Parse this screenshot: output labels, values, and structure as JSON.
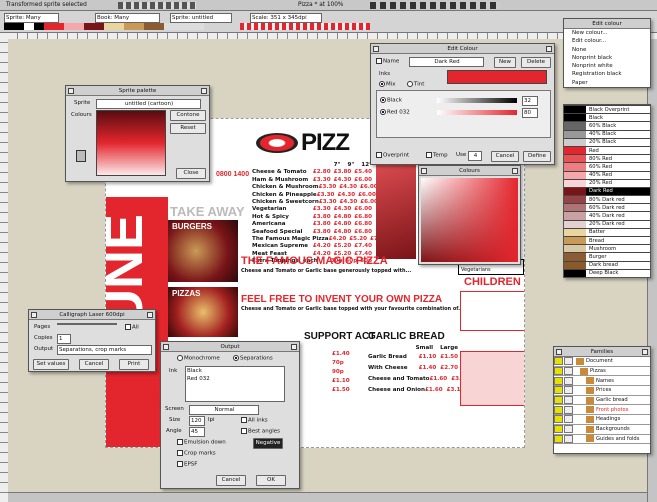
{
  "menubar": {
    "doc_title": "Transformed sprite selected",
    "window_title": "Pizza * at 100%"
  },
  "toolbar": {
    "sprite": "Sprite: Many",
    "book": "Book: Many",
    "sprite_name": "Sprite: untitled",
    "scale": "Scale: 351 x 345dpi"
  },
  "sprite_window": {
    "title": "Sprite palette",
    "sprite_label": "Sprite",
    "sprite_value": "untitled (cartoon)",
    "colours_label": "Colours",
    "contone": "Contone",
    "reset": "Reset",
    "close": "Close"
  },
  "edit_colour": {
    "title": "Edit Colour",
    "name_label": "Name",
    "name_value": "Dark Red",
    "new": "New",
    "delete": "Delete",
    "inks": "Inks",
    "mix": "Mix",
    "tint": "Tint",
    "ink1": "Black",
    "ink2": "Red 032",
    "v1": "32",
    "v2": "80",
    "overprint": "Overprint",
    "temp": "Temp",
    "use": "Use",
    "use_value": "4",
    "cancel": "Cancel",
    "define": "Define"
  },
  "colours_panel": {
    "title": "Colours"
  },
  "edit_menu": {
    "title": "Edit colour",
    "items": [
      "New colour...",
      "Edit colour...",
      "None",
      "Nonprint black",
      "Nonprint white",
      "Registration black",
      "Paper"
    ]
  },
  "palette": [
    {
      "name": "Black Overprint",
      "color": "#000000"
    },
    {
      "name": "Black",
      "color": "#000000"
    },
    {
      "name": "60% Black",
      "color": "#666666"
    },
    {
      "name": "40% Black",
      "color": "#999999"
    },
    {
      "name": "20% Black",
      "color": "#cccccc"
    },
    {
      "name": "Red",
      "color": "#e3262d"
    },
    {
      "name": "80% Red",
      "color": "#e85257"
    },
    {
      "name": "60% Red",
      "color": "#ee7d81"
    },
    {
      "name": "40% Red",
      "color": "#f4a8ab"
    },
    {
      "name": "20% Red",
      "color": "#f9d4d5"
    },
    {
      "name": "Dark Red",
      "color": "#7a1418"
    },
    {
      "name": "80% Dark red",
      "color": "#954347"
    },
    {
      "name": "60% Dark red",
      "color": "#af7275"
    },
    {
      "name": "40% Dark red",
      "color": "#caa1a3"
    },
    {
      "name": "20% Dark red",
      "color": "#e4d0d1"
    },
    {
      "name": "Batter",
      "color": "#e9d59e"
    },
    {
      "name": "Bread",
      "color": "#c99a55"
    },
    {
      "name": "Mushroom",
      "color": "#d9c7a4"
    },
    {
      "name": "Burger",
      "color": "#8d5b32"
    },
    {
      "name": "Dark bread",
      "color": "#8a5a2b"
    },
    {
      "name": "Deep Black",
      "color": "#000000"
    }
  ],
  "families": {
    "title": "Families",
    "items": [
      "Document",
      "Pizzas",
      "Names",
      "Prices",
      "Garlic bread",
      "Front photos",
      "Headings",
      "Backgrounds",
      "Guides and folds"
    ]
  },
  "flyer": {
    "pizza": "PIZZ",
    "take_away": "TAKE AWAY",
    "burgers": "BURGERS",
    "pizzas": "PIZZAS",
    "big": "UNE",
    "magic": "THE FAMOUS MAGIC PIZZA",
    "magic_sub": "Cheese and Tomato or Garlic base generously topped with...",
    "invent": "FEEL FREE TO INVENT YOUR OWN PIZZA",
    "invent_sub": "Cheese and Tomato or Garlic base topped with your favourite combination of...",
    "support": "SUPPORT ACT",
    "garlic": "GARLIC BREAD",
    "children": "CHILDREN",
    "veg": "Suitable for Vegetarians",
    "free1": "or FREE",
    "free2": "DELIVERY",
    "phone": "0800 1400",
    "sizes": [
      "7\"",
      "9\"",
      "12\""
    ],
    "small": "Small",
    "large": "Large",
    "menu": [
      {
        "name": "Cheese & Tomato",
        "p": [
          "£2.80",
          "£3.80",
          "£5.40"
        ]
      },
      {
        "name": "Ham & Mushroom",
        "p": [
          "£3.30",
          "£4.30",
          "£6.00"
        ]
      },
      {
        "name": "Chicken & Mushroom",
        "p": [
          "£3.30",
          "£4.30",
          "£6.00"
        ]
      },
      {
        "name": "Chicken & Pineapple",
        "p": [
          "£3.30",
          "£4.30",
          "£6.00"
        ]
      },
      {
        "name": "Chicken & Sweetcorn",
        "p": [
          "£3.30",
          "£4.30",
          "£6.00"
        ]
      },
      {
        "name": "Vegetarian",
        "p": [
          "£3.30",
          "£4.30",
          "£6.00"
        ]
      },
      {
        "name": "Hot & Spicy",
        "p": [
          "£3.80",
          "£4.80",
          "£6.80"
        ]
      },
      {
        "name": "Americana",
        "p": [
          "£3.80",
          "£4.80",
          "£6.80"
        ]
      },
      {
        "name": "Seafood Special",
        "p": [
          "£3.80",
          "£4.80",
          "£6.80"
        ]
      },
      {
        "name": "The Famous Magic Pizza",
        "p": [
          "£4.20",
          "£5.20",
          "£7.40"
        ]
      },
      {
        "name": "Mexican Supreme",
        "p": [
          "£4.20",
          "£5.20",
          "£7.40"
        ]
      },
      {
        "name": "Meat Feast",
        "p": [
          "£4.20",
          "£5.20",
          "£7.40"
        ]
      },
      {
        "name": "Extra Toppings, each",
        "p": [
          "30p",
          "40p",
          "50p"
        ]
      }
    ],
    "garlic_rows": [
      {
        "name": "Garlic Bread",
        "s": "£1.10",
        "l": "£1.50"
      },
      {
        "name": "With Cheese",
        "s": "£1.40",
        "l": "£2.70"
      },
      {
        "name": "Cheese and Tomato",
        "s": "£1.60",
        "l": "£3.10"
      },
      {
        "name": "Cheese and Onion",
        "s": "£1.60",
        "l": "£3.10"
      }
    ],
    "support_prices": [
      "£1.40",
      "70p",
      "90p",
      "£1.10",
      "£1.50"
    ]
  },
  "print_window": {
    "title": "Calligraph Laser 600dpi",
    "pages": "Pages",
    "all": "All",
    "copies": "Copies",
    "copies_value": "1",
    "output": "Output",
    "output_value": "Separations, crop marks",
    "set_values": "Set values",
    "cancel": "Cancel",
    "print": "Print"
  },
  "output_window": {
    "title": "Output",
    "mono": "Monochrome",
    "seps": "Separations",
    "ink": "Ink",
    "inks": [
      "Black",
      "Red 032"
    ],
    "screen": "Screen",
    "screen_value": "Normal",
    "size": "Size",
    "size_value": "120",
    "lpi": "lpi",
    "angle": "Angle",
    "angle_value": "45",
    "all_inks": "All inks",
    "best": "Best angles",
    "negative": "Negative",
    "emulsion": "Emulsion down",
    "crop": "Crop marks",
    "epsf": "EPSF",
    "cancel": "Cancel",
    "ok": "OK"
  }
}
